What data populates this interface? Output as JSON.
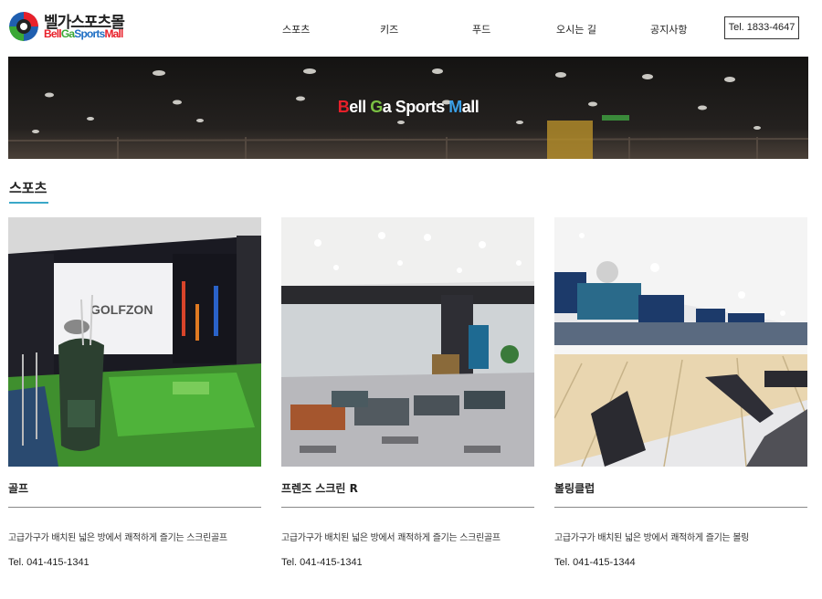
{
  "brand": {
    "name_ko": "벨가스포츠몰",
    "name_en_parts": [
      {
        "text": "Bell",
        "color": "#e8202a"
      },
      {
        "text": "Ga",
        "color": "#3aa835"
      },
      {
        "text": "Sports",
        "color": "#1f6fc4"
      },
      {
        "text": "Mall",
        "color": "#e8202a"
      }
    ]
  },
  "nav": {
    "items": [
      {
        "label": "스포츠"
      },
      {
        "label": "키즈"
      },
      {
        "label": "푸드"
      },
      {
        "label": "오시는 길"
      },
      {
        "label": "공지사항"
      }
    ],
    "tel_label": "Tel. 1833-4647"
  },
  "hero": {
    "title_parts": [
      {
        "text": "B",
        "color": "#e8202a"
      },
      {
        "text": "ell ",
        "color": "#ffffff"
      },
      {
        "text": "G",
        "color": "#7ac143"
      },
      {
        "text": "a Sports ",
        "color": "#ffffff"
      },
      {
        "text": "M",
        "color": "#3aa0e8"
      },
      {
        "text": "all",
        "color": "#ffffff"
      }
    ]
  },
  "section": {
    "title": "스포츠"
  },
  "cards": [
    {
      "name": "골프",
      "desc": "고급가구가 배치된 넓은 방에서 쾌적하게 즐기는 스크린골프",
      "tel": "Tel. 041-415-1341",
      "photo_icon": "golf-simulator-photo",
      "screen_text": "GOLFZON"
    },
    {
      "name": "프렌즈 스크린 R",
      "desc": "고급가구가 배치된 넓은 방에서 쾌적하게 즐기는 스크린골프",
      "tel": "Tel. 041-415-1341",
      "photo_icon": "lounge-photo"
    },
    {
      "name": "볼링클럽",
      "desc": "고급가구가 배치된 넓은 방에서 쾌적하게 즐기는 볼링",
      "tel": "Tel. 041-415-1344",
      "photo_icon": "bowling-alley-photo"
    }
  ]
}
